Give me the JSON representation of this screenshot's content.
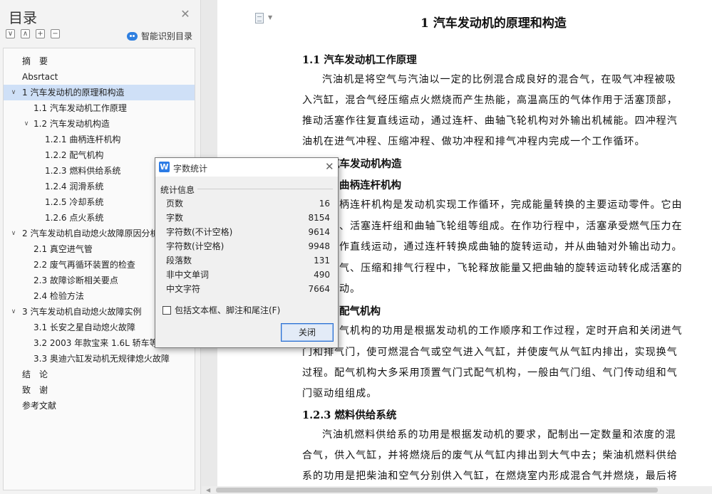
{
  "nav": {
    "title": "目录",
    "tools": [
      "∨",
      "∧",
      "+",
      "−"
    ],
    "smart_toc": "智能识别目录",
    "toc": [
      {
        "label": "摘　要",
        "level": 0,
        "arrow": ""
      },
      {
        "label": "Absrtact",
        "level": 0,
        "arrow": ""
      },
      {
        "label": "1  汽车发动机的原理和构造",
        "level": 0,
        "arrow": "∨",
        "selected": true
      },
      {
        "label": "1.1  汽车发动机工作原理",
        "level": 1,
        "arrow": ""
      },
      {
        "label": "1.2  汽车发动机构造",
        "level": 1,
        "arrow": "∨"
      },
      {
        "label": "1.2.1  曲柄连杆机构",
        "level": 2,
        "arrow": ""
      },
      {
        "label": "1.2.2  配气机构",
        "level": 2,
        "arrow": ""
      },
      {
        "label": "1.2.3  燃料供给系统",
        "level": 2,
        "arrow": ""
      },
      {
        "label": "1.2.4  润滑系统",
        "level": 2,
        "arrow": ""
      },
      {
        "label": "1.2.5  冷却系统",
        "level": 2,
        "arrow": ""
      },
      {
        "label": "1.2.6  点火系统",
        "level": 2,
        "arrow": ""
      },
      {
        "label": "2  汽车发动机自动熄火故障原因分析",
        "level": 0,
        "arrow": "∨"
      },
      {
        "label": "2.1  真空进气管",
        "level": 1,
        "arrow": ""
      },
      {
        "label": "2.2  废气再循环装置的检查",
        "level": 1,
        "arrow": ""
      },
      {
        "label": "2.3  故障诊断相关要点",
        "level": 1,
        "arrow": ""
      },
      {
        "label": "2.4  检验方法",
        "level": 1,
        "arrow": ""
      },
      {
        "label": "3  汽车发动机自动熄火故障实例",
        "level": 0,
        "arrow": "∨"
      },
      {
        "label": "3.1  长安之星自动熄火故障",
        "level": 1,
        "arrow": ""
      },
      {
        "label": "3.2 2003 年款宝来 1.6L 轿车等级",
        "level": 1,
        "arrow": ""
      },
      {
        "label": "3.3  奥迪六缸发动机无规律熄火故障",
        "level": 1,
        "arrow": ""
      },
      {
        "label": "结　论",
        "level": 0,
        "arrow": ""
      },
      {
        "label": "致　谢",
        "level": 0,
        "arrow": ""
      },
      {
        "label": "参考文献",
        "level": 0,
        "arrow": ""
      }
    ]
  },
  "doc": {
    "h1": "1  汽车发动机的原理和构造",
    "h_1_1": "1.1  汽车发动机工作原理",
    "p1": [
      "汽油机是将空气与汽油以一定的比例混合成良好的混合气，在吸气冲程被吸",
      "入汽缸，混合气经压缩点火燃烧而产生热能，高温高压的气体作用于活塞顶部，",
      "推动活塞作往复直线运动，通过连杆、曲轴飞轮机构对外输出机械能。四冲程汽",
      "油机在进气冲程、压缩冲程、做功冲程和排气冲程内完成一个工作循环。"
    ],
    "h_1_2": "汽车发动机构造",
    "h_1_2_1": "曲柄连杆机构",
    "p2": [
      "柄连杆机构是发动机实现工作循环，完成能量转换的主要运动零件。它由",
      "、活塞连杆组和曲轴飞轮组等组成。在作功行程中，活塞承受燃气压力在",
      "作直线运动，通过连杆转换成曲轴的旋转运动，并从曲轴对外输出动力。",
      "气、压缩和排气行程中，飞轮释放能量又把曲轴的旋转运动转化成活塞的",
      "动。"
    ],
    "h_1_2_2": "配气机构",
    "p3": [
      "气机构的功用是根据发动机的工作顺序和工作过程，定时开启和关闭进气",
      "门和排气门，使可燃混合气或空气进入气缸，并使废气从气缸内排出，实现换气",
      "过程。配气机构大多采用顶置气门式配气机构，一般由气门组、气门传动组和气",
      "门驱动组组成。"
    ],
    "h_1_2_3": "1.2.3  燃料供给系统",
    "p4": [
      "汽油机燃料供给系的功用是根据发动机的要求，配制出一定数量和浓度的混",
      "合气，供入气缸，并将燃烧后的废气从气缸内排出到大气中去；柴油机燃料供给",
      "系的功用是把柴油和空气分别供入气缸，在燃烧室内形成混合气并燃烧，最后将"
    ]
  },
  "dialog": {
    "title": "字数统计",
    "group": "统计信息",
    "stats": [
      {
        "label": "页数",
        "value": "16"
      },
      {
        "label": "字数",
        "value": "8154"
      },
      {
        "label": "字符数(不计空格)",
        "value": "9614"
      },
      {
        "label": "字符数(计空格)",
        "value": "9948"
      },
      {
        "label": "段落数",
        "value": "131"
      },
      {
        "label": "非中文单词",
        "value": "490"
      },
      {
        "label": "中文字符",
        "value": "7664"
      }
    ],
    "include_label": "包括文本框、脚注和尾注(F)",
    "include_checked": false,
    "close_button": "关闭"
  }
}
